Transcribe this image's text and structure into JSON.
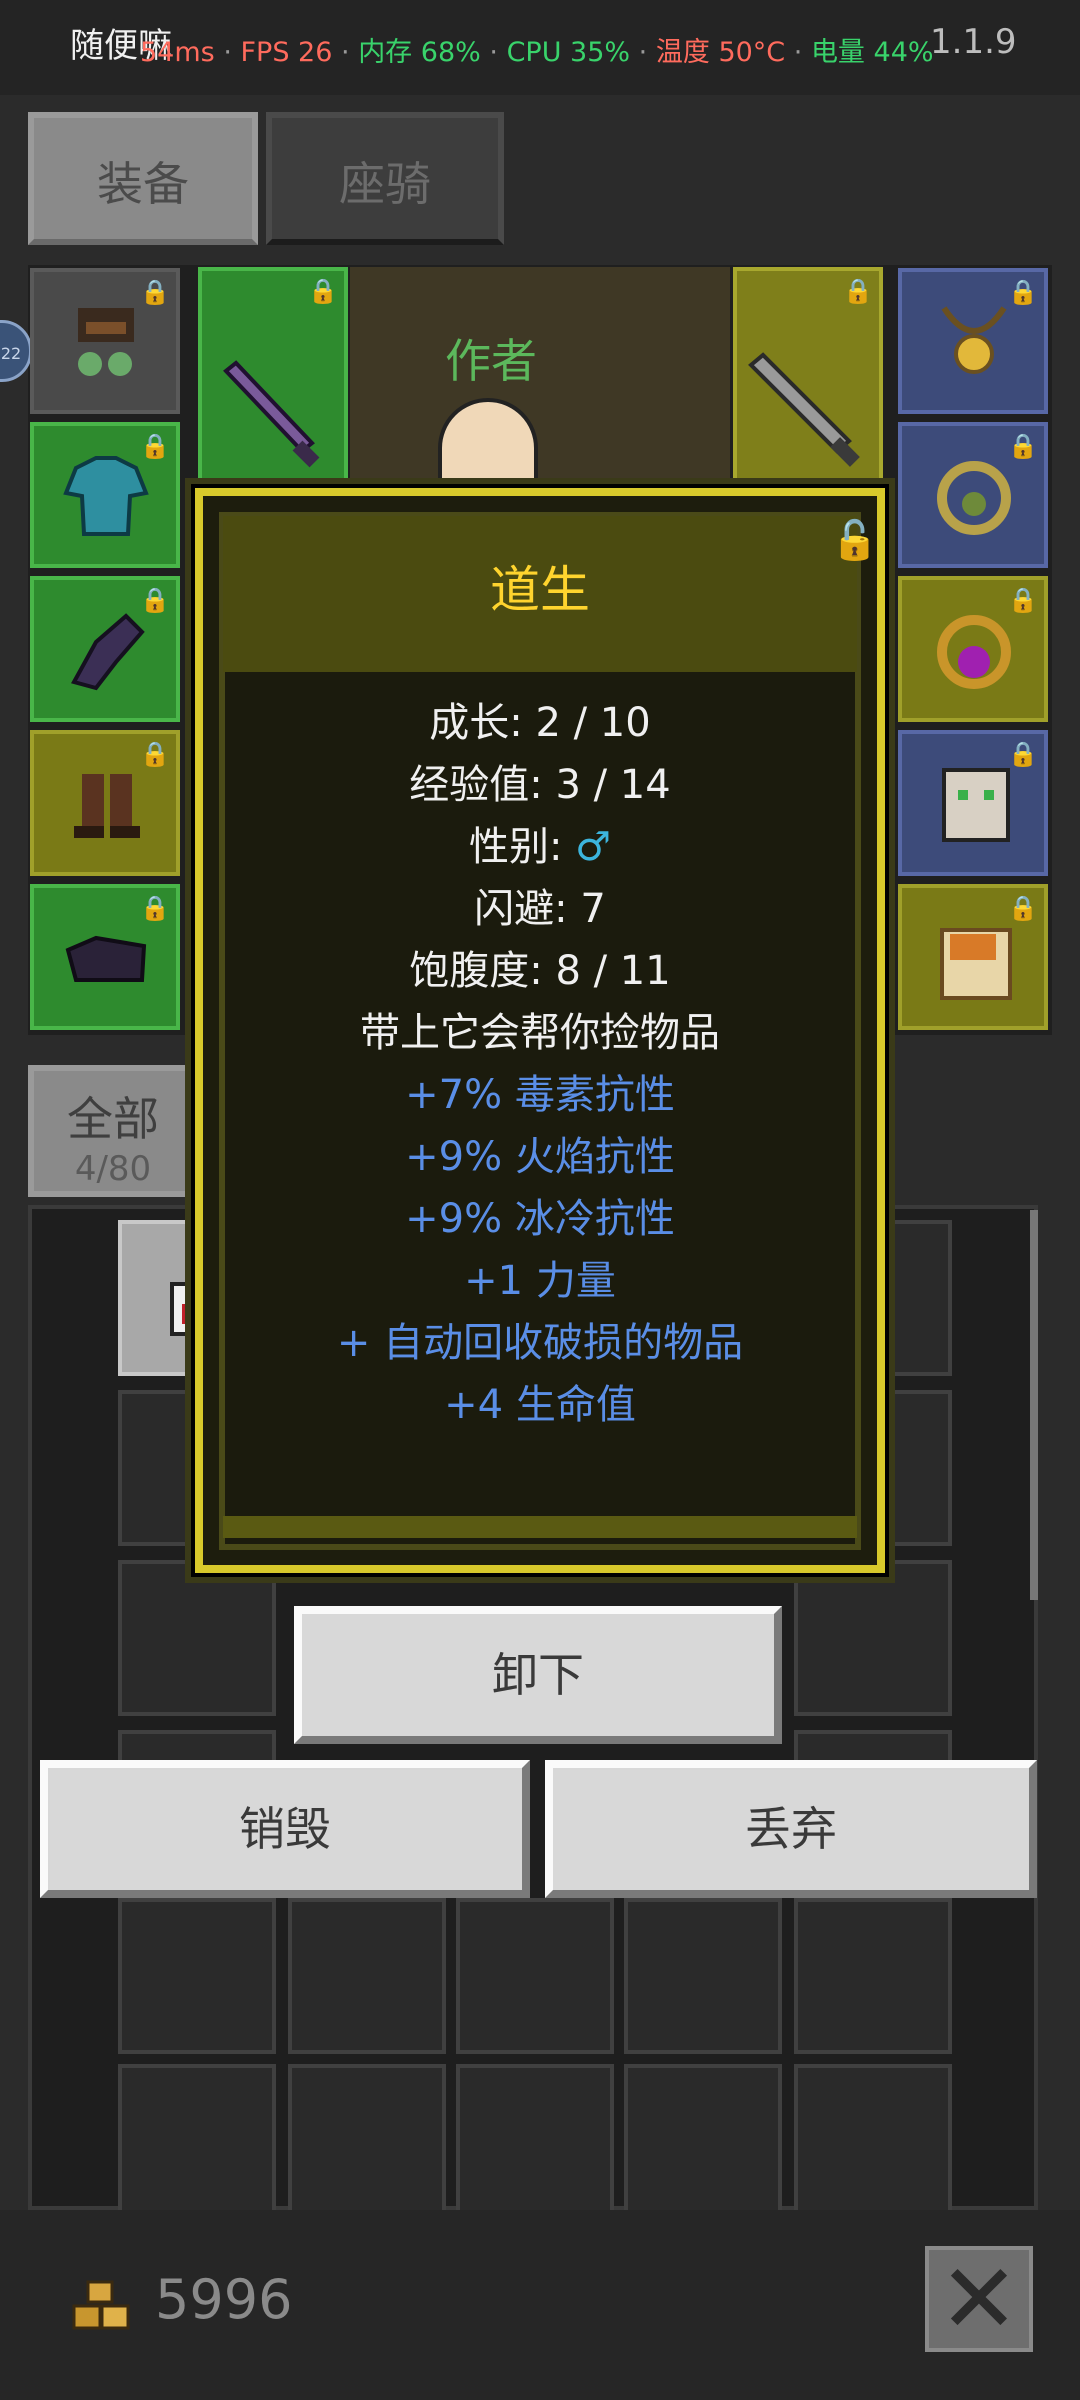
{
  "status": {
    "app_name": "随便嘛",
    "version": "1.1.9",
    "metrics": [
      "54ms",
      "FPS 26",
      "内存 68%",
      "CPU 35%",
      "温度 50°C",
      "电量 44%"
    ],
    "separator": "·"
  },
  "tabs": {
    "equipment": "装备",
    "mount": "座骑"
  },
  "character": {
    "label": "作者"
  },
  "side_badge": "22",
  "filter": {
    "label": "全部",
    "count": "4/80"
  },
  "dialog": {
    "title": "道生",
    "stats": [
      "成长: 2 / 10",
      "经验值: 3 / 14"
    ],
    "gender_label": "性别: ",
    "gender_value": "♂",
    "stats2": [
      "闪避: 7",
      "饱腹度: 8 / 11",
      "带上它会帮你捡物品"
    ],
    "bonuses": [
      "+7% 毒素抗性",
      "+9% 火焰抗性",
      "+9% 冰冷抗性",
      "+1 力量",
      "+ 自动回收破损的物品",
      "+4 生命值"
    ]
  },
  "buttons": {
    "unequip": "卸下",
    "destroy": "销毁",
    "drop": "丢弃"
  },
  "gold": "5996",
  "close_icon": "close-icon",
  "colors": {
    "title": "#ffd42e",
    "bonus": "#5a8ee6",
    "gender": "#3cb4dc",
    "dialog_border": "#d8c92b"
  }
}
